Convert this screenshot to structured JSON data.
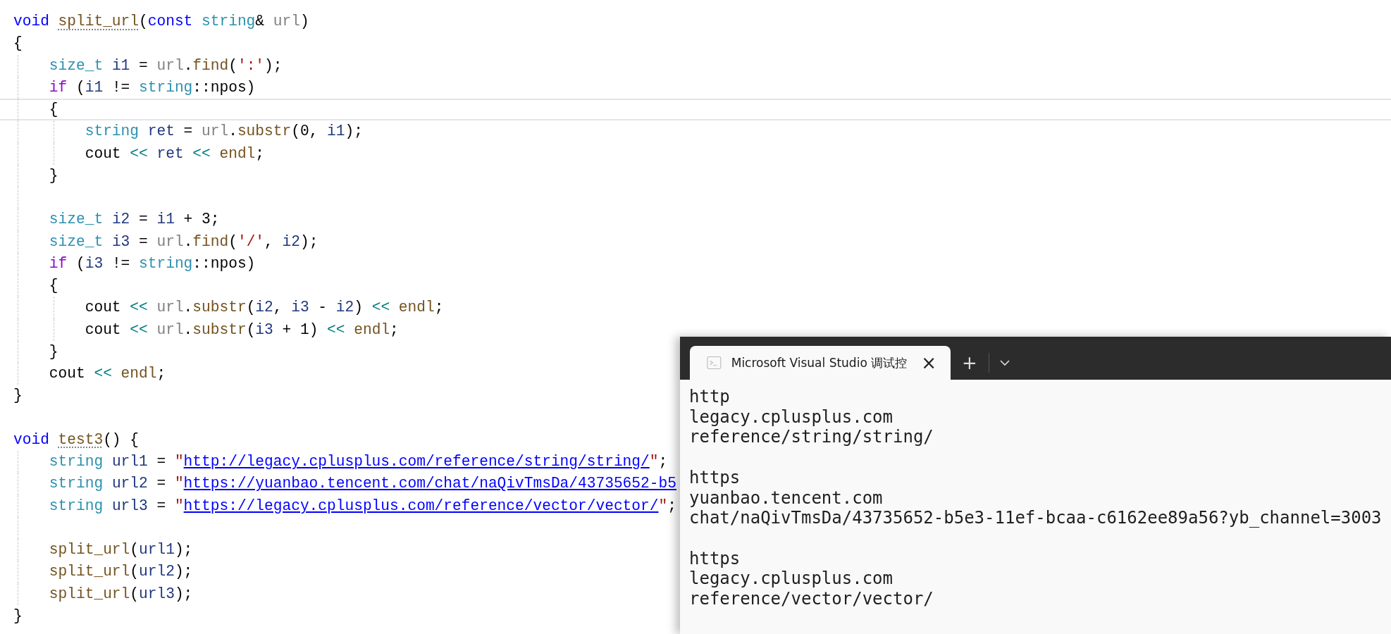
{
  "editor": {
    "lines": [
      {
        "current": false,
        "tokens": [
          {
            "kind": "keyword",
            "text": "void "
          },
          {
            "kind": "hint_function",
            "text": "split_url"
          },
          {
            "kind": "plain",
            "text": "("
          },
          {
            "kind": "keyword",
            "text": "const "
          },
          {
            "kind": "type",
            "text": "string"
          },
          {
            "kind": "plain",
            "text": "& "
          },
          {
            "kind": "parameter",
            "text": "url"
          },
          {
            "kind": "plain",
            "text": ")"
          }
        ]
      },
      {
        "current": false,
        "tokens": [
          {
            "kind": "plain",
            "text": "{"
          }
        ]
      },
      {
        "current": false,
        "tokens": [
          {
            "kind": "type",
            "text": "    size_t "
          },
          {
            "kind": "local",
            "text": "i1"
          },
          {
            "kind": "plain",
            "text": " = "
          },
          {
            "kind": "parameter",
            "text": "url"
          },
          {
            "kind": "plain",
            "text": "."
          },
          {
            "kind": "function",
            "text": "find"
          },
          {
            "kind": "plain",
            "text": "("
          },
          {
            "kind": "string",
            "text": "':'"
          },
          {
            "kind": "plain",
            "text": ");"
          }
        ]
      },
      {
        "current": false,
        "tokens": [
          {
            "kind": "control",
            "text": "    if"
          },
          {
            "kind": "plain",
            "text": " ("
          },
          {
            "kind": "local",
            "text": "i1"
          },
          {
            "kind": "plain",
            "text": " != "
          },
          {
            "kind": "type",
            "text": "string"
          },
          {
            "kind": "plain",
            "text": "::npos)"
          }
        ]
      },
      {
        "current": true,
        "tokens": [
          {
            "kind": "plain",
            "text": "    {"
          }
        ]
      },
      {
        "current": false,
        "tokens": [
          {
            "kind": "type",
            "text": "        string "
          },
          {
            "kind": "local",
            "text": "ret"
          },
          {
            "kind": "plain",
            "text": " = "
          },
          {
            "kind": "parameter",
            "text": "url"
          },
          {
            "kind": "plain",
            "text": "."
          },
          {
            "kind": "function",
            "text": "substr"
          },
          {
            "kind": "plain",
            "text": "(0, "
          },
          {
            "kind": "local",
            "text": "i1"
          },
          {
            "kind": "plain",
            "text": ");"
          }
        ]
      },
      {
        "current": false,
        "tokens": [
          {
            "kind": "plain",
            "text": "        cout "
          },
          {
            "kind": "operator",
            "text": "<< "
          },
          {
            "kind": "local",
            "text": "ret "
          },
          {
            "kind": "operator",
            "text": "<< "
          },
          {
            "kind": "function",
            "text": "endl"
          },
          {
            "kind": "plain",
            "text": ";"
          }
        ]
      },
      {
        "current": false,
        "tokens": [
          {
            "kind": "plain",
            "text": "    }"
          }
        ]
      },
      {
        "current": false
      },
      {
        "current": false,
        "tokens": [
          {
            "kind": "type",
            "text": "    size_t "
          },
          {
            "kind": "local",
            "text": "i2"
          },
          {
            "kind": "plain",
            "text": " = "
          },
          {
            "kind": "local",
            "text": "i1"
          },
          {
            "kind": "plain",
            "text": " + 3;"
          }
        ]
      },
      {
        "current": false,
        "tokens": [
          {
            "kind": "type",
            "text": "    size_t "
          },
          {
            "kind": "local",
            "text": "i3"
          },
          {
            "kind": "plain",
            "text": " = "
          },
          {
            "kind": "parameter",
            "text": "url"
          },
          {
            "kind": "plain",
            "text": "."
          },
          {
            "kind": "function",
            "text": "find"
          },
          {
            "kind": "plain",
            "text": "("
          },
          {
            "kind": "string",
            "text": "'/'"
          },
          {
            "kind": "plain",
            "text": ", "
          },
          {
            "kind": "local",
            "text": "i2"
          },
          {
            "kind": "plain",
            "text": ");"
          }
        ]
      },
      {
        "current": false,
        "tokens": [
          {
            "kind": "control",
            "text": "    if"
          },
          {
            "kind": "plain",
            "text": " ("
          },
          {
            "kind": "local",
            "text": "i3"
          },
          {
            "kind": "plain",
            "text": " != "
          },
          {
            "kind": "type",
            "text": "string"
          },
          {
            "kind": "plain",
            "text": "::npos)"
          }
        ]
      },
      {
        "current": false,
        "tokens": [
          {
            "kind": "plain",
            "text": "    {"
          }
        ]
      },
      {
        "current": false,
        "tokens": [
          {
            "kind": "plain",
            "text": "        cout "
          },
          {
            "kind": "operator",
            "text": "<< "
          },
          {
            "kind": "parameter",
            "text": "url"
          },
          {
            "kind": "plain",
            "text": "."
          },
          {
            "kind": "function",
            "text": "substr"
          },
          {
            "kind": "plain",
            "text": "("
          },
          {
            "kind": "local",
            "text": "i2"
          },
          {
            "kind": "plain",
            "text": ", "
          },
          {
            "kind": "local",
            "text": "i3"
          },
          {
            "kind": "plain",
            "text": " - "
          },
          {
            "kind": "local",
            "text": "i2"
          },
          {
            "kind": "plain",
            "text": ") "
          },
          {
            "kind": "operator",
            "text": "<< "
          },
          {
            "kind": "function",
            "text": "endl"
          },
          {
            "kind": "plain",
            "text": ";"
          }
        ]
      },
      {
        "current": false,
        "tokens": [
          {
            "kind": "plain",
            "text": "        cout "
          },
          {
            "kind": "operator",
            "text": "<< "
          },
          {
            "kind": "parameter",
            "text": "url"
          },
          {
            "kind": "plain",
            "text": "."
          },
          {
            "kind": "function",
            "text": "substr"
          },
          {
            "kind": "plain",
            "text": "("
          },
          {
            "kind": "local",
            "text": "i3"
          },
          {
            "kind": "plain",
            "text": " + 1) "
          },
          {
            "kind": "operator",
            "text": "<< "
          },
          {
            "kind": "function",
            "text": "endl"
          },
          {
            "kind": "plain",
            "text": ";"
          }
        ]
      },
      {
        "current": false,
        "tokens": [
          {
            "kind": "plain",
            "text": "    }"
          }
        ]
      },
      {
        "current": false,
        "tokens": [
          {
            "kind": "plain",
            "text": "    cout "
          },
          {
            "kind": "operator",
            "text": "<< "
          },
          {
            "kind": "function",
            "text": "endl"
          },
          {
            "kind": "plain",
            "text": ";"
          }
        ]
      },
      {
        "current": false,
        "tokens": [
          {
            "kind": "plain",
            "text": "}"
          }
        ]
      },
      {
        "current": false
      },
      {
        "current": false,
        "tokens": [
          {
            "kind": "keyword",
            "text": "void "
          },
          {
            "kind": "hint_function",
            "text": "test3"
          },
          {
            "kind": "plain",
            "text": "() {"
          }
        ]
      },
      {
        "current": false,
        "tokens": [
          {
            "kind": "type",
            "text": "    string "
          },
          {
            "kind": "local",
            "text": "url1"
          },
          {
            "kind": "plain",
            "text": " = "
          },
          {
            "kind": "string",
            "text": "\""
          },
          {
            "kind": "link",
            "text": "http://legacy.cplusplus.com/reference/string/string/"
          },
          {
            "kind": "string",
            "text": "\""
          },
          {
            "kind": "plain",
            "text": ";"
          }
        ]
      },
      {
        "current": false,
        "tokens": [
          {
            "kind": "type",
            "text": "    string "
          },
          {
            "kind": "local",
            "text": "url2"
          },
          {
            "kind": "plain",
            "text": " = "
          },
          {
            "kind": "string",
            "text": "\""
          },
          {
            "kind": "link",
            "text": "https://yuanbao.tencent.com/chat/naQivTmsDa/43735652-b5"
          }
        ]
      },
      {
        "current": false,
        "tokens": [
          {
            "kind": "type",
            "text": "    string "
          },
          {
            "kind": "local",
            "text": "url3"
          },
          {
            "kind": "plain",
            "text": " = "
          },
          {
            "kind": "string",
            "text": "\""
          },
          {
            "kind": "link",
            "text": "https://legacy.cplusplus.com/reference/vector/vector/"
          },
          {
            "kind": "string",
            "text": "\""
          },
          {
            "kind": "plain",
            "text": ";"
          }
        ]
      },
      {
        "current": false
      },
      {
        "current": false,
        "tokens": [
          {
            "kind": "function",
            "text": "    split_url"
          },
          {
            "kind": "plain",
            "text": "("
          },
          {
            "kind": "local",
            "text": "url1"
          },
          {
            "kind": "plain",
            "text": ");"
          }
        ]
      },
      {
        "current": false,
        "tokens": [
          {
            "kind": "function",
            "text": "    split_url"
          },
          {
            "kind": "plain",
            "text": "("
          },
          {
            "kind": "local",
            "text": "url2"
          },
          {
            "kind": "plain",
            "text": ");"
          }
        ]
      },
      {
        "current": false,
        "tokens": [
          {
            "kind": "function",
            "text": "    split_url"
          },
          {
            "kind": "plain",
            "text": "("
          },
          {
            "kind": "local",
            "text": "url3"
          },
          {
            "kind": "plain",
            "text": ");"
          }
        ]
      },
      {
        "current": false,
        "tokens": [
          {
            "kind": "plain",
            "text": "}"
          }
        ]
      }
    ]
  },
  "terminal": {
    "tab": {
      "title": "Microsoft Visual Studio 调试控",
      "close": "×"
    },
    "new_tab": "+",
    "output_groups": [
      [
        "http",
        "legacy.cplusplus.com",
        "reference/string/string/"
      ],
      [
        "https",
        "yuanbao.tencent.com",
        "chat/naQivTmsDa/43735652-b5e3-11ef-bcaa-c6162ee89a56?yb_channel=3003"
      ],
      [
        "https",
        "legacy.cplusplus.com",
        "reference/vector/vector/"
      ]
    ]
  }
}
